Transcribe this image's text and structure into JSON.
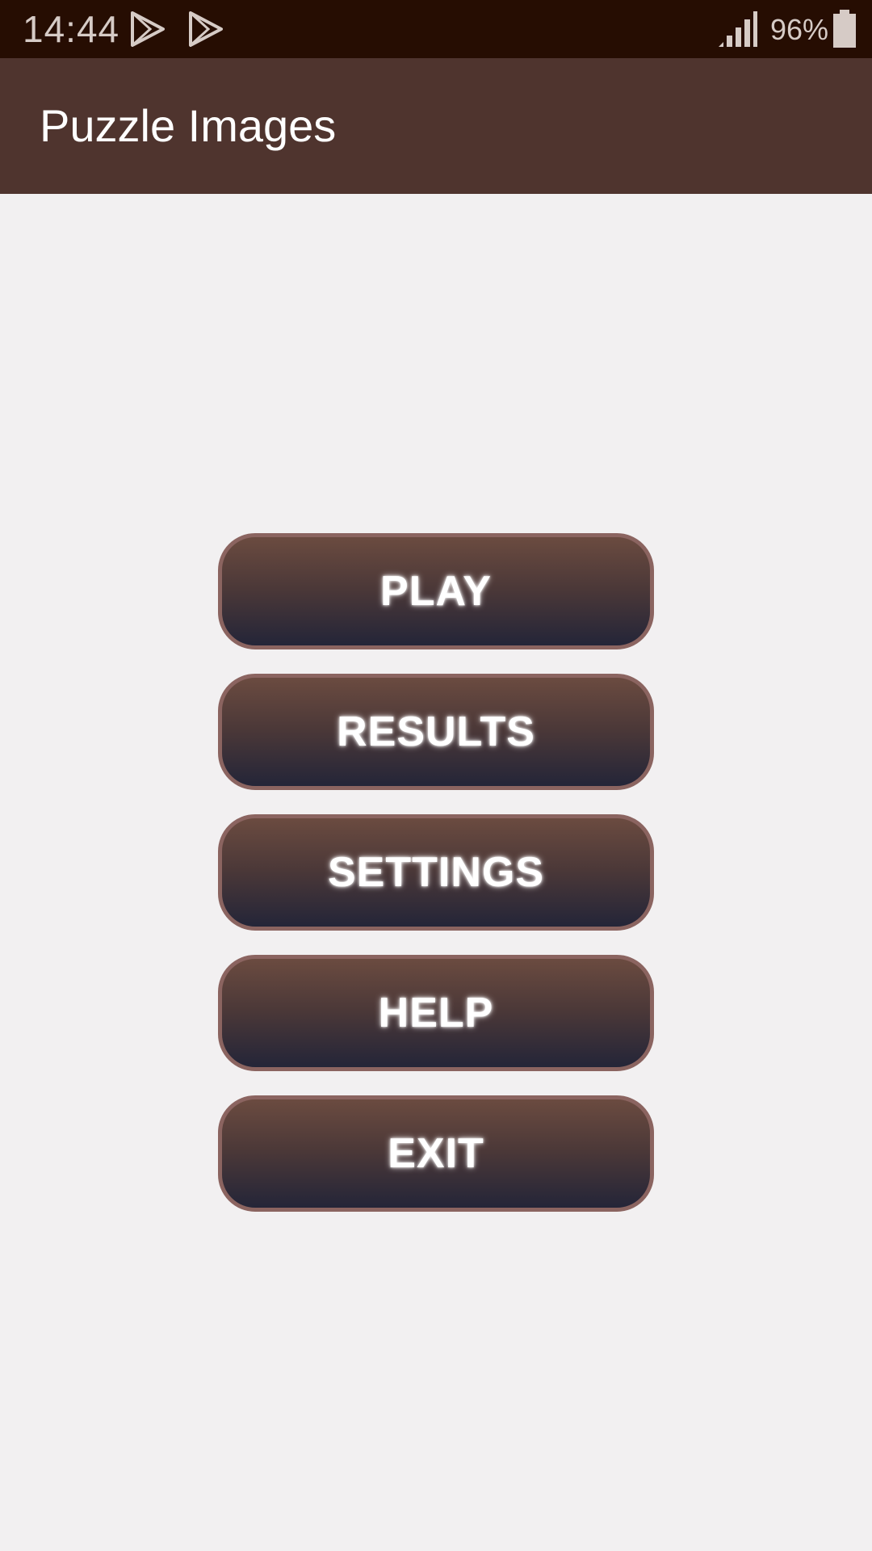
{
  "status_bar": {
    "time": "14:44",
    "battery": "96%",
    "icons": [
      "play-store-icon",
      "play-store-icon",
      "signal-icon",
      "battery-icon"
    ]
  },
  "app_bar": {
    "title": "Puzzle Images"
  },
  "menu": {
    "play_label": "PLAY",
    "results_label": "RESULTS",
    "settings_label": "SETTINGS",
    "help_label": "HELP",
    "exit_label": "EXIT"
  },
  "colors": {
    "status_bar_background": "#260d02",
    "app_bar_background": "#4f342e",
    "page_background": "#f2f0f1",
    "button_border": "#8b6460",
    "button_gradient_top": "#6b4b40",
    "button_gradient_bottom": "#242538",
    "button_text": "#ffffff"
  }
}
